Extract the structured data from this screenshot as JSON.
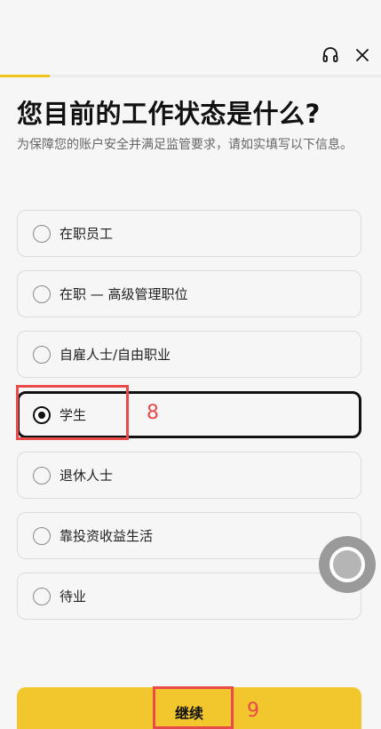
{
  "progress": {
    "fraction": 0.13
  },
  "icons": {
    "support": "headset-icon",
    "close": "close-icon"
  },
  "question": {
    "title": "您目前的工作状态是什么?",
    "subtitle": "为保障您的账户安全并满足监管要求，请如实填写以下信息。"
  },
  "options": [
    {
      "label": "在职员工",
      "selected": false
    },
    {
      "label": "在职 — 高级管理职位",
      "selected": false
    },
    {
      "label": "自雇人士/自由职业",
      "selected": false
    },
    {
      "label": "学生",
      "selected": true
    },
    {
      "label": "退休人士",
      "selected": false
    },
    {
      "label": "靠投资收益生活",
      "selected": false
    },
    {
      "label": "待业",
      "selected": false
    }
  ],
  "annotations": {
    "option_marker": "8",
    "continue_marker": "9"
  },
  "footer": {
    "continue_label": "继续"
  },
  "colors": {
    "accent": "#f2c72d",
    "annotation": "#e94b4b"
  }
}
